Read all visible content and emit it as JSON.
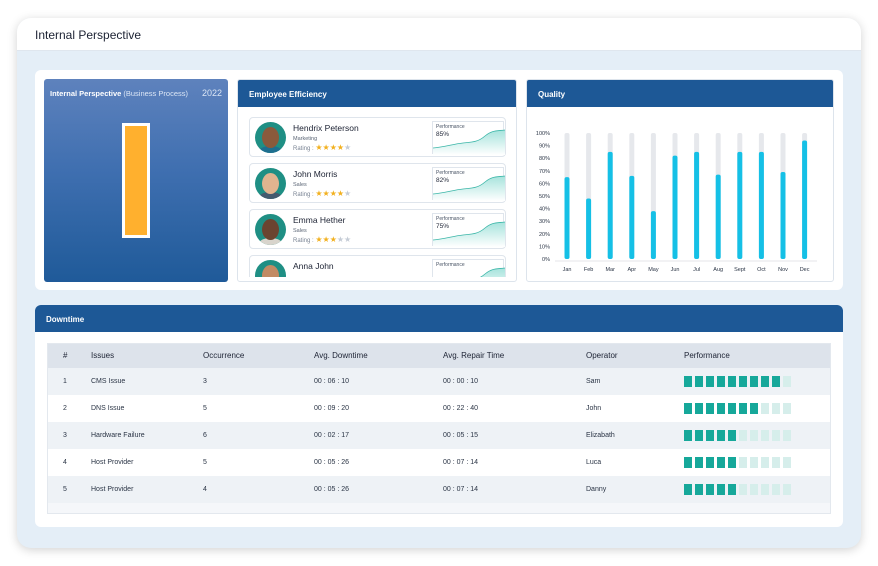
{
  "header": {
    "title": "Internal Perspective"
  },
  "kpi": {
    "title_bold": "Internal Perspective",
    "title_rest": " (Business Process)",
    "year": "2022",
    "fill_fraction": 1.0,
    "bar_color": "#ffb02e"
  },
  "efficiency": {
    "title": "Employee Efficiency",
    "rating_label": "Rating :",
    "perf_label": "Performance",
    "employees": [
      {
        "name": "Hendrix Peterson",
        "dept": "Marketing",
        "stars": 4,
        "performance": "85%",
        "skin": "#8a5a3c",
        "shirt": "#1e6f8f"
      },
      {
        "name": "John Morris",
        "dept": "Sales",
        "stars": 4,
        "performance": "82%",
        "skin": "#e0b48f",
        "shirt": "#445a6e"
      },
      {
        "name": "Emma Hether",
        "dept": "Sales",
        "stars": 3,
        "performance": "75%",
        "skin": "#6b4430",
        "shirt": "#d8d4cc"
      },
      {
        "name": "Anna John",
        "dept": "",
        "stars": 0,
        "performance": "",
        "skin": "#c28b64",
        "shirt": "#7a4a9a"
      }
    ]
  },
  "quality": {
    "title": "Quality",
    "chart_data": {
      "type": "bar",
      "categories": [
        "Jan",
        "Feb",
        "Mar",
        "Apr",
        "May",
        "Jun",
        "Jul",
        "Aug",
        "Sept",
        "Oct",
        "Nov",
        "Dec"
      ],
      "values": [
        65,
        48,
        85,
        66,
        38,
        82,
        85,
        67,
        85,
        85,
        69,
        94
      ],
      "ylim": [
        0,
        100
      ],
      "yticks": [
        "0%",
        "10%",
        "20%",
        "30%",
        "40%",
        "50%",
        "60%",
        "70%",
        "80%",
        "90%",
        "100%"
      ],
      "bar_color": "#15c0e6",
      "track_color": "#e6e8ec"
    }
  },
  "downtime": {
    "title": "Downtime",
    "columns": [
      "#",
      "Issues",
      "Occurrence",
      "Avg. Downtime",
      "Avg. Repair Time",
      "Operator",
      "Performance"
    ],
    "rows": [
      {
        "num": "1",
        "issue": "CMS Issue",
        "occ": "3",
        "down": "00 : 06 : 10",
        "repair": "00 : 00 : 10",
        "op": "Sam",
        "perf": 9
      },
      {
        "num": "2",
        "issue": "DNS Issue",
        "occ": "5",
        "down": "00 : 09 : 20",
        "repair": "00 : 22 : 40",
        "op": "John",
        "perf": 7
      },
      {
        "num": "3",
        "issue": "Hardware Failure",
        "occ": "6",
        "down": "00 : 02 : 17",
        "repair": "00 : 05 : 15",
        "op": "Elizabath",
        "perf": 5
      },
      {
        "num": "4",
        "issue": "Host Provider",
        "occ": "5",
        "down": "00 : 05 : 26",
        "repair": "00 : 07 : 14",
        "op": "Luca",
        "perf": 5
      },
      {
        "num": "5",
        "issue": "Host Provider",
        "occ": "4",
        "down": "00 : 05 : 26",
        "repair": "00 : 07 : 14",
        "op": "Danny",
        "perf": 5
      }
    ],
    "perf_total": 10
  }
}
